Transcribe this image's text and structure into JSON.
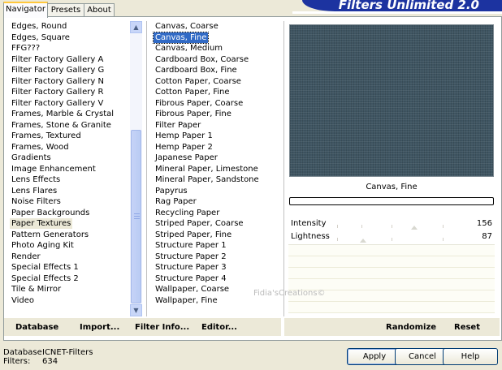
{
  "tabs": [
    {
      "label": "Navigator",
      "active": true
    },
    {
      "label": "Presets",
      "active": false
    },
    {
      "label": "About",
      "active": false
    }
  ],
  "banner": {
    "title": "Filters Unlimited 2.0",
    "color": "#1c33a0"
  },
  "categories": {
    "items": [
      "Edges, Round",
      "Edges, Square",
      "FFG???",
      "Filter Factory Gallery A",
      "Filter Factory Gallery G",
      "Filter Factory Gallery N",
      "Filter Factory Gallery R",
      "Filter Factory Gallery V",
      "Frames, Marble & Crystal",
      "Frames, Stone & Granite",
      "Frames, Textured",
      "Frames, Wood",
      "Gradients",
      "Image Enhancement",
      "Lens Effects",
      "Lens Flares",
      "Noise Filters",
      "Paper Backgrounds",
      "Paper Textures",
      "Pattern Generators",
      "Photo Aging Kit",
      "Render",
      "Special Effects 1",
      "Special Effects 2",
      "Tile & Mirror",
      "Video"
    ],
    "selected": "Paper Textures"
  },
  "filters": {
    "items": [
      "Canvas, Coarse",
      "Canvas, Fine",
      "Canvas, Medium",
      "Cardboard Box, Coarse",
      "Cardboard Box, Fine",
      "Cotton Paper, Coarse",
      "Cotton Paper, Fine",
      "Fibrous Paper, Coarse",
      "Fibrous Paper, Fine",
      "Filter Paper",
      "Hemp Paper 1",
      "Hemp Paper 2",
      "Japanese Paper",
      "Mineral Paper, Limestone",
      "Mineral Paper, Sandstone",
      "Papyrus",
      "Rag Paper",
      "Recycling Paper",
      "Striped Paper, Coarse",
      "Striped Paper, Fine",
      "Structure Paper 1",
      "Structure Paper 2",
      "Structure Paper 3",
      "Structure Paper 4",
      "Wallpaper, Coarse",
      "Wallpaper, Fine"
    ],
    "selected": "Canvas, Fine",
    "selection_color": "#316ac5"
  },
  "preview": {
    "filter_name": "Canvas, Fine",
    "color": "#3f5562"
  },
  "params": [
    {
      "label": "Intensity",
      "value": "156",
      "level": 156,
      "max": 255
    },
    {
      "label": "Lightness",
      "value": "87",
      "level": 87,
      "max": 255
    }
  ],
  "watermark": "Fidia'sCreations©",
  "toolbar": {
    "database_label": "Database",
    "import_label": "Import...",
    "filter_info_label": "Filter Info...",
    "editor_label": "Editor...",
    "randomize_label": "Randomize",
    "reset_label": "Reset"
  },
  "footer": {
    "database_key": "Database:",
    "database_value": "ICNET-Filters",
    "filters_key": "Filters:",
    "filters_value": "634"
  },
  "buttons": {
    "apply": "Apply",
    "cancel": "Cancel",
    "help": "Help"
  }
}
